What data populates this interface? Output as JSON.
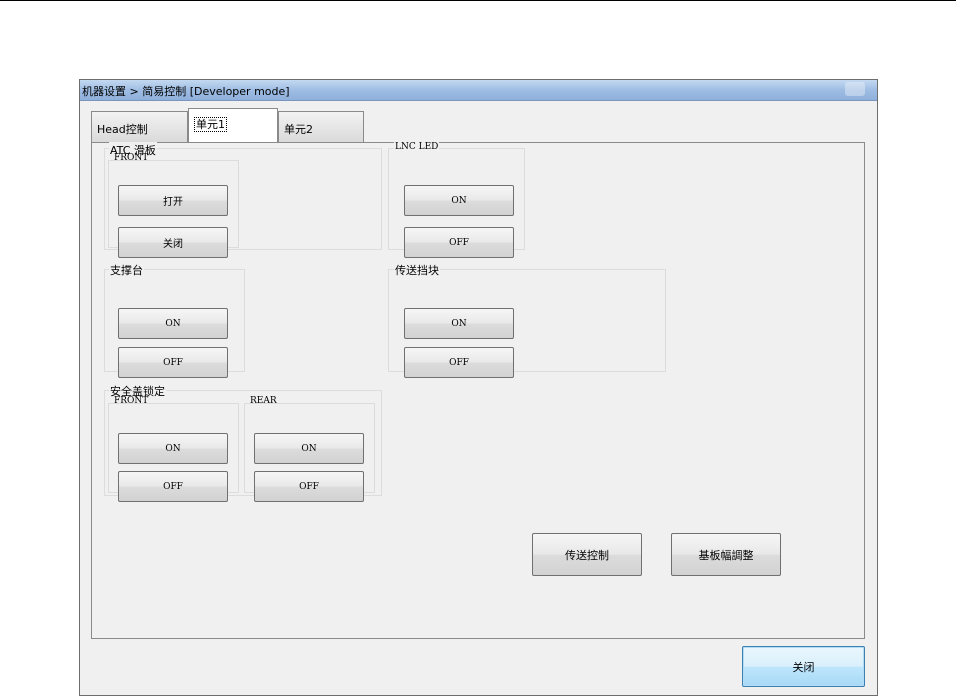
{
  "window": {
    "title": "机器设置 > 简易控制 [Developer mode]"
  },
  "tabs": [
    {
      "label": "Head控制"
    },
    {
      "label": "单元1"
    },
    {
      "label": "单元2"
    }
  ],
  "groups": {
    "atc": {
      "title": "ATC 滑板",
      "sub": "FRONT",
      "btn_open": "打开",
      "btn_close": "关闭"
    },
    "lnc": {
      "title": "LNC LED",
      "btn_on": "ON",
      "btn_off": "OFF"
    },
    "support": {
      "title": "支撑台",
      "btn_on": "ON",
      "btn_off": "OFF"
    },
    "stopper": {
      "title": "传送挡块",
      "btn_on": "ON",
      "btn_off": "OFF"
    },
    "cover": {
      "title": "安全盖锁定",
      "front": {
        "sub": "FRONT",
        "btn_on": "ON",
        "btn_off": "OFF"
      },
      "rear": {
        "sub": "REAR",
        "btn_on": "ON",
        "btn_off": "OFF"
      }
    }
  },
  "actions": {
    "transfer_control": "传送控制",
    "board_width_adjust": "基板幅調整"
  },
  "footer": {
    "close": "关闭"
  }
}
